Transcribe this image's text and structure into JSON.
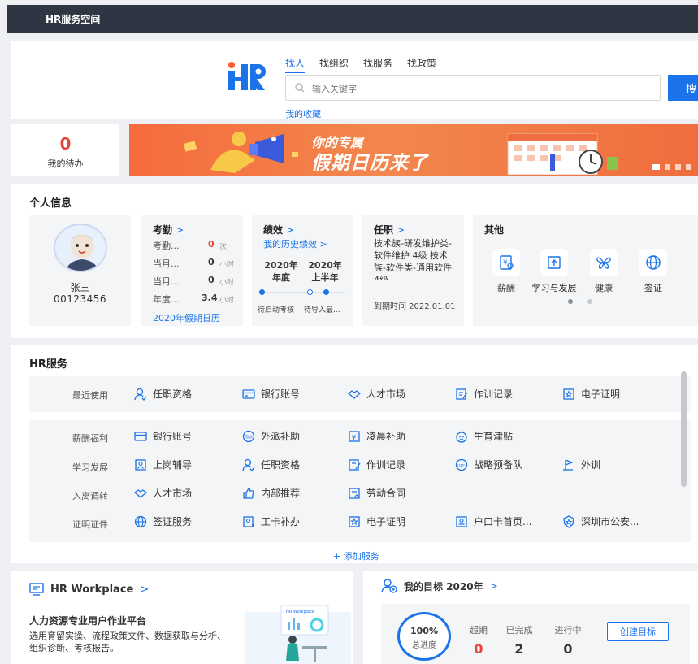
{
  "app": {
    "title": "HR服务空间"
  },
  "search": {
    "tabs": [
      "找人",
      "找组织",
      "找服务",
      "找政策"
    ],
    "placeholder": "输入关键字",
    "button_label": "搜",
    "favorites_link": "我的收藏"
  },
  "todo": {
    "count": "0",
    "label": "我的待办"
  },
  "banner": {
    "line1": "你的专属",
    "line2": "假期日历来了"
  },
  "personal": {
    "title": "个人信息",
    "user": {
      "name": "张三",
      "id": "00123456"
    },
    "attendance": {
      "title": "考勤",
      "rows": [
        {
          "label": "考勤...",
          "value": "0",
          "unit": "次"
        },
        {
          "label": "当月...",
          "value": "0",
          "unit": "小时"
        },
        {
          "label": "当月...",
          "value": "0",
          "unit": "小时"
        },
        {
          "label": "年度...",
          "value": "3.4",
          "unit": "小时"
        }
      ],
      "link": "2020年假期日历"
    },
    "performance": {
      "title": "绩效",
      "sub_link": "我的历史绩效 >",
      "col1": "2020年年度",
      "col2": "2020年上半年",
      "status1": "待启动考核",
      "status2": "待导入最..."
    },
    "job": {
      "title": "任职",
      "desc": "技术族-研发维护类-软件维护 4级 技术族-软件类-通用软件 4级",
      "expire": "到期时间 2022.01.01"
    },
    "other": {
      "title": "其他",
      "items": [
        "薪酬",
        "学习与发展",
        "健康",
        "签证"
      ]
    }
  },
  "hr_services": {
    "title": "HR服务",
    "recent_label": "最近使用",
    "recent": [
      "任职资格",
      "银行账号",
      "人才市场",
      "作训记录",
      "电子证明"
    ],
    "categories": [
      {
        "label": "薪酬福利",
        "items": [
          "银行账号",
          "外派补助",
          "凌晨补助",
          "生育津贴"
        ]
      },
      {
        "label": "学习发展",
        "items": [
          "上岗辅导",
          "任职资格",
          "作训记录",
          "战略预备队",
          "外训"
        ]
      },
      {
        "label": "入离调转",
        "items": [
          "人才市场",
          "内部推荐",
          "劳动合同"
        ]
      },
      {
        "label": "证明证件",
        "items": [
          "签证服务",
          "工卡补办",
          "电子证明",
          "户口卡首页...",
          "深圳市公安..."
        ]
      }
    ],
    "add_link": "+ 添加服务"
  },
  "workplace": {
    "title": "HR Workplace",
    "headline": "人力资源专业用户作业平台",
    "desc": "选用育留实操、流程政策文件、数据获取与分析、组织诊断、考核报告。",
    "illustration_label": "HR Workplace"
  },
  "goals": {
    "title": "我的目标 2020年",
    "progress": "100%",
    "progress_label": "总进度",
    "overdue_label": "超期",
    "overdue": "0",
    "done_label": "已完成",
    "done": "2",
    "ongoing_label": "进行中",
    "ongoing": "0",
    "create_label": "创建目标"
  },
  "colors": {
    "accent": "#1a73e8",
    "alert": "#e8453c",
    "topbar": "#2f3542",
    "banner": "#f56b3d"
  }
}
